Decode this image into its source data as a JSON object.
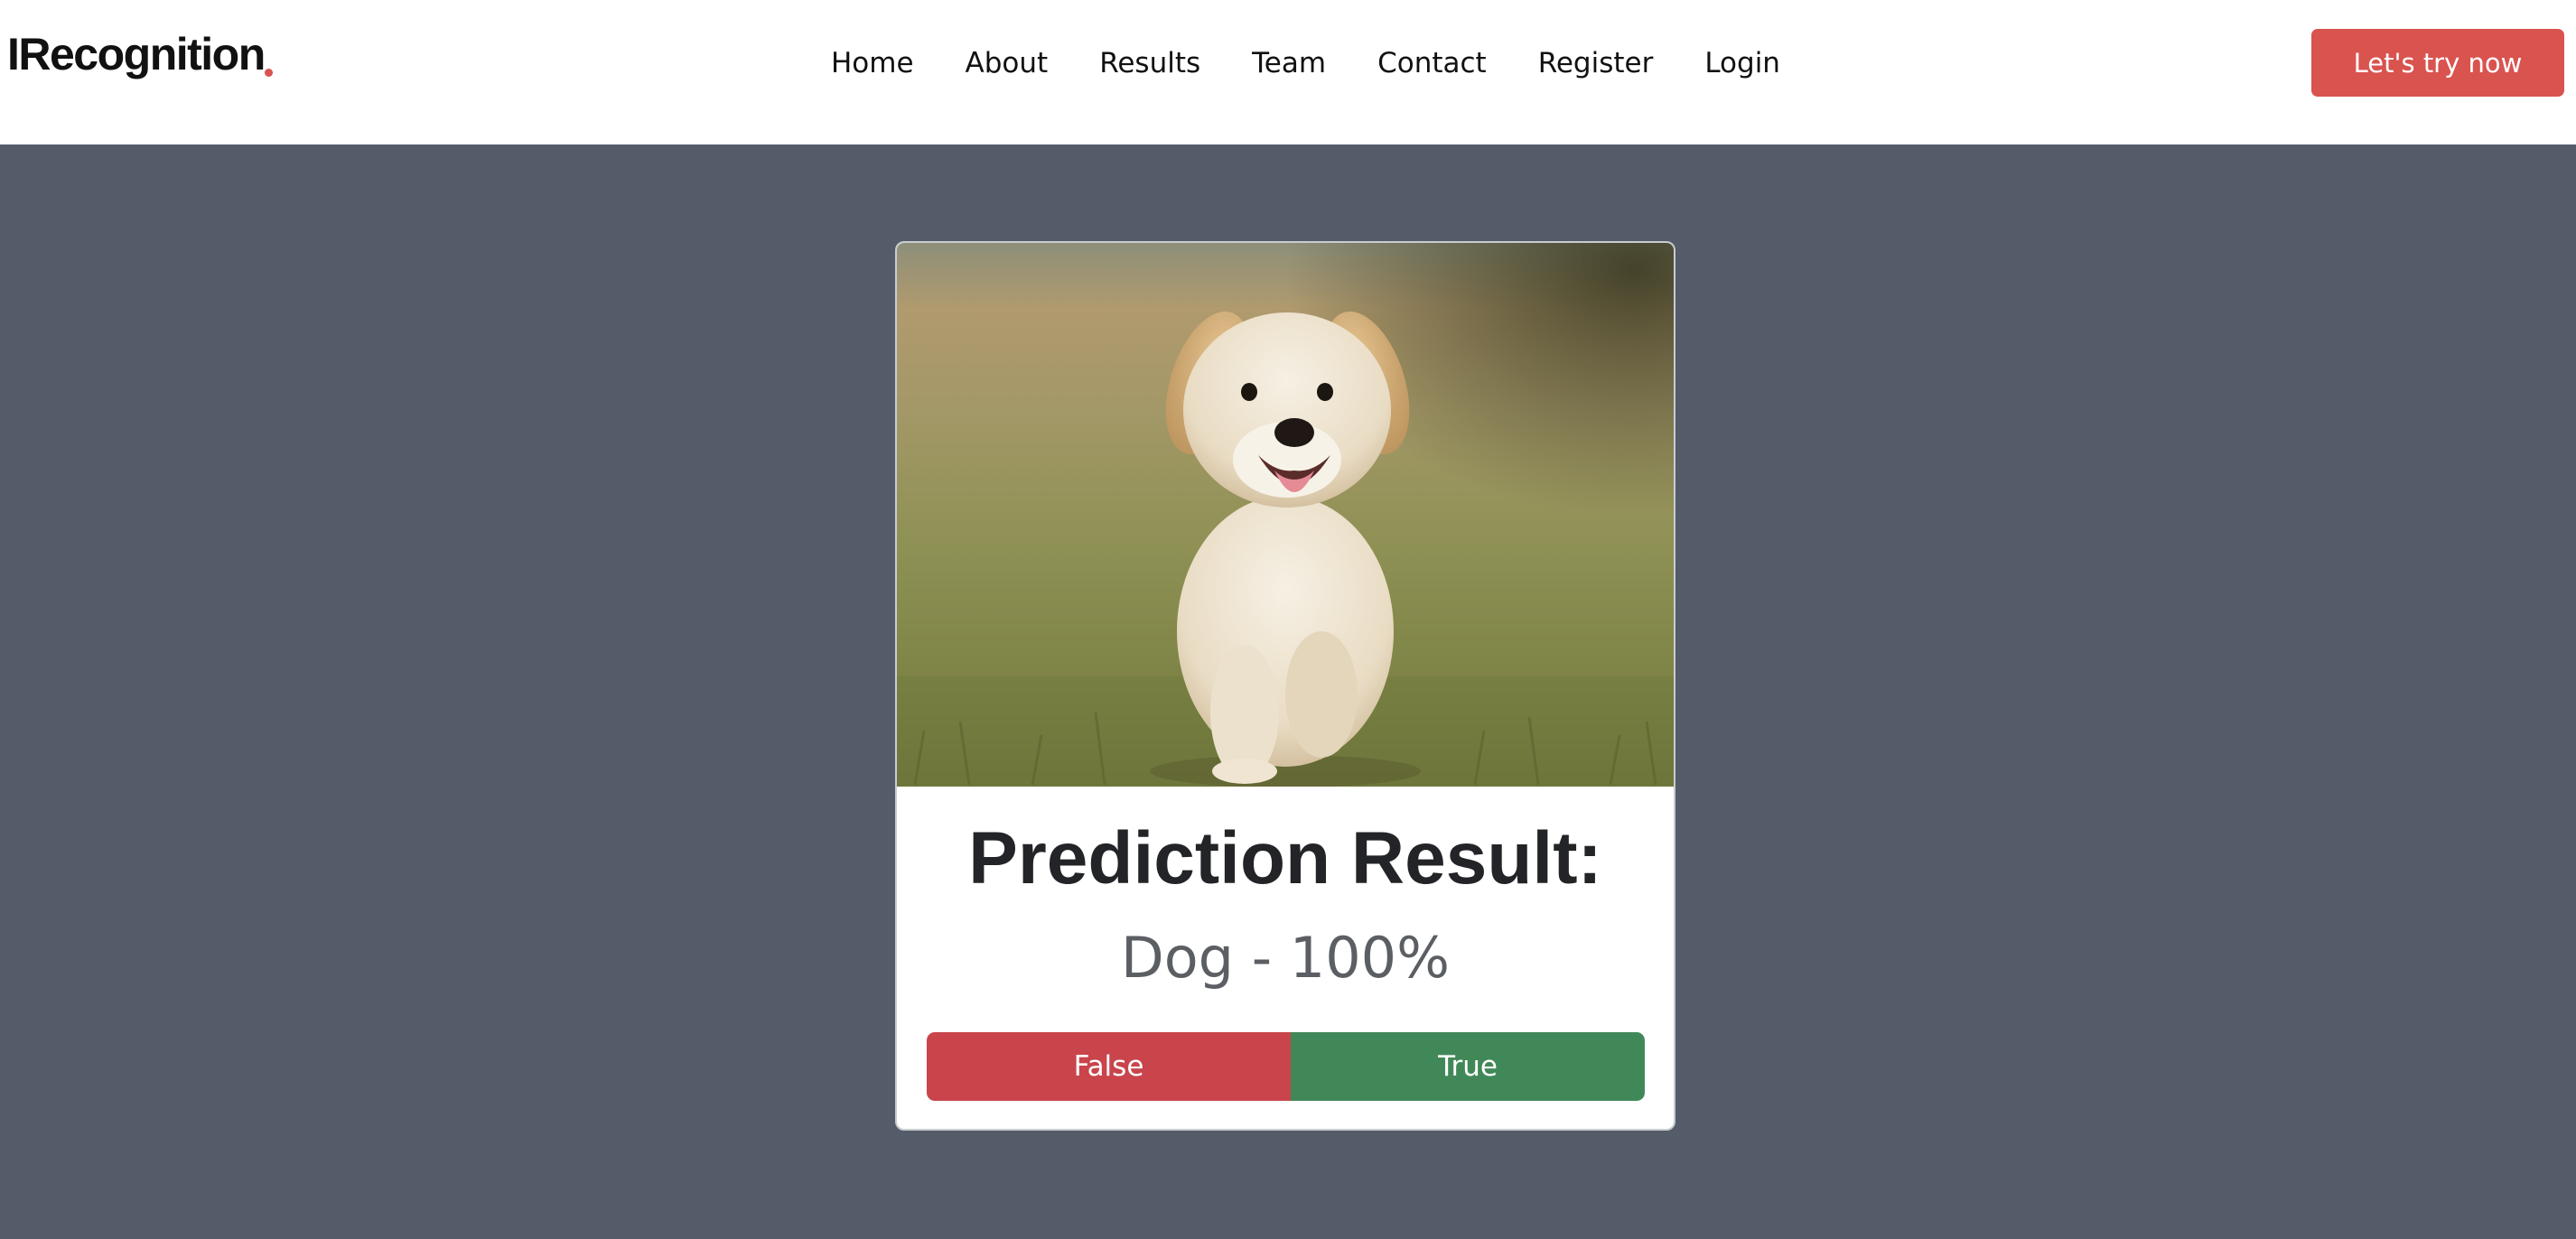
{
  "header": {
    "logo": "IRecognition",
    "nav": [
      "Home",
      "About",
      "Results",
      "Team",
      "Contact",
      "Register",
      "Login"
    ],
    "cta_label": "Let's try now"
  },
  "card": {
    "image_icon": "puppy-photo",
    "title": "Prediction Result:",
    "prediction": "Dog - 100%",
    "false_label": "False",
    "true_label": "True"
  },
  "colors": {
    "accent": "#d9534f",
    "page_background": "#545b69",
    "false_button": "#c9444b",
    "true_button": "#418858"
  }
}
